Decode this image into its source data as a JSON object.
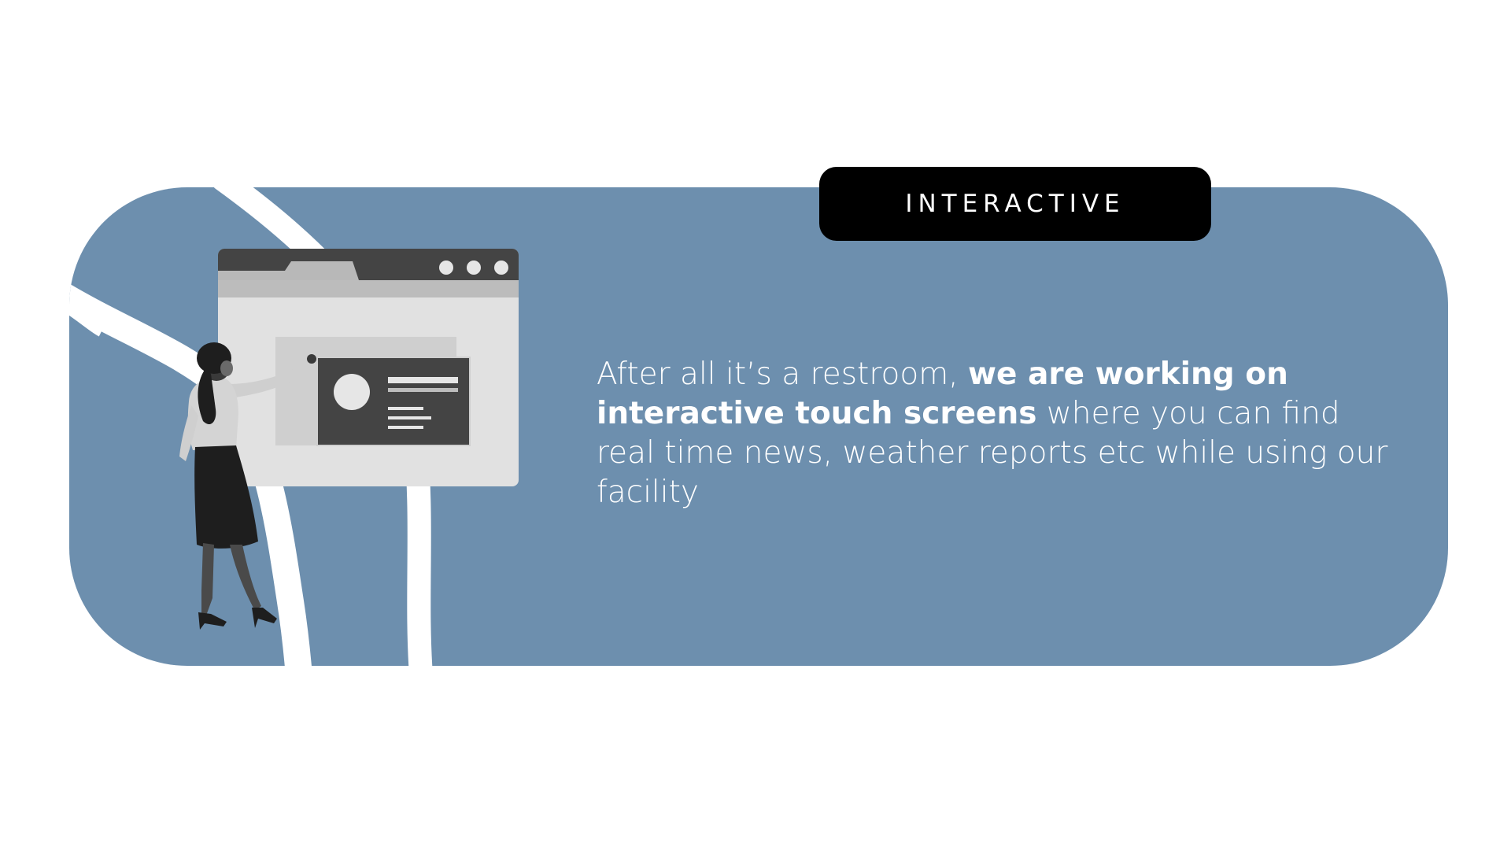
{
  "badge": {
    "label": "INTERACTIVE"
  },
  "description": {
    "intro": "After all it’s a restroom, ",
    "emphasis": "we are working on interactive touch screens",
    "rest": " where you can find real time news, weather reports etc while using our facility"
  },
  "colors": {
    "panel": "#6d8fae",
    "badge_bg": "#000000",
    "text": "#ffffff"
  },
  "illustration": {
    "subject": "woman-presenting-at-browser-window",
    "icons": [
      "browser-window-icon",
      "window-dots-icon",
      "content-card-icon",
      "avatar-circle-icon"
    ]
  }
}
